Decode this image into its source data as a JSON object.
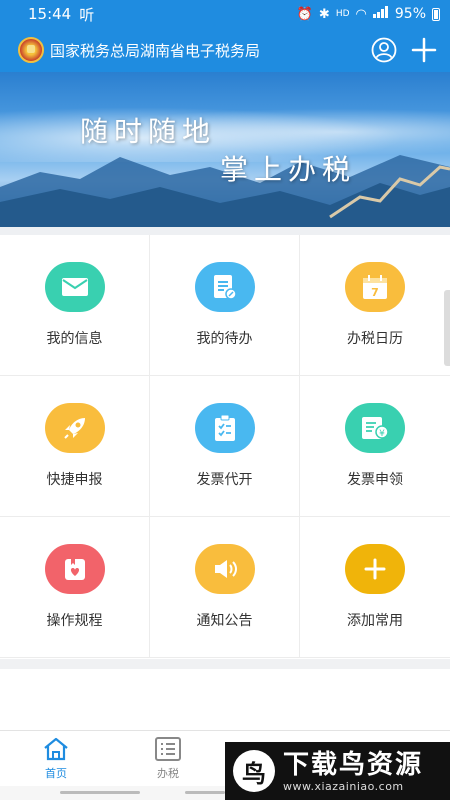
{
  "status_bar": {
    "time": "15:44",
    "carrier_icon": "听",
    "hd_label": "HD",
    "signal_label": "4G",
    "battery": "95%"
  },
  "header": {
    "title": "国家税务总局湖南省电子税务局",
    "emblem_icon": "tax-emblem",
    "user_icon": "user-circle-icon",
    "add_icon": "plus-icon"
  },
  "banner": {
    "slogan_line1": "随时随地",
    "slogan_line2": "掌上办税"
  },
  "grid": [
    {
      "label": "我的信息",
      "icon": "mail-icon",
      "color": "#39d0b0"
    },
    {
      "label": "我的待办",
      "icon": "todo-edit-icon",
      "color": "#49b8f0"
    },
    {
      "label": "办税日历",
      "icon": "calendar-icon",
      "color": "#f9bd3d"
    },
    {
      "label": "快捷申报",
      "icon": "rocket-icon",
      "color": "#f9bd3d"
    },
    {
      "label": "发票代开",
      "icon": "clipboard-check-icon",
      "color": "#49b8f0"
    },
    {
      "label": "发票申领",
      "icon": "invoice-yen-icon",
      "color": "#39d0b0"
    },
    {
      "label": "操作规程",
      "icon": "heart-book-icon",
      "color": "#f2636a"
    },
    {
      "label": "通知公告",
      "icon": "speaker-icon",
      "color": "#f9bd3d"
    },
    {
      "label": "添加常用",
      "icon": "plus-icon",
      "color": "#f0b40a"
    }
  ],
  "calendar_day": "7",
  "tabbar": {
    "items": [
      {
        "label": "首页",
        "icon": "home-icon",
        "active": true
      },
      {
        "label": "办税",
        "icon": "list-icon",
        "active": false
      },
      {
        "label": "",
        "icon": "heart-icon",
        "active": false
      },
      {
        "label": "",
        "icon": "person-icon",
        "active": false
      }
    ]
  },
  "watermark": {
    "title": "下载鸟资源",
    "url": "www.xiazainiao.com"
  },
  "colors": {
    "brand": "#1f8ce0",
    "grid_border": "#ececec"
  }
}
